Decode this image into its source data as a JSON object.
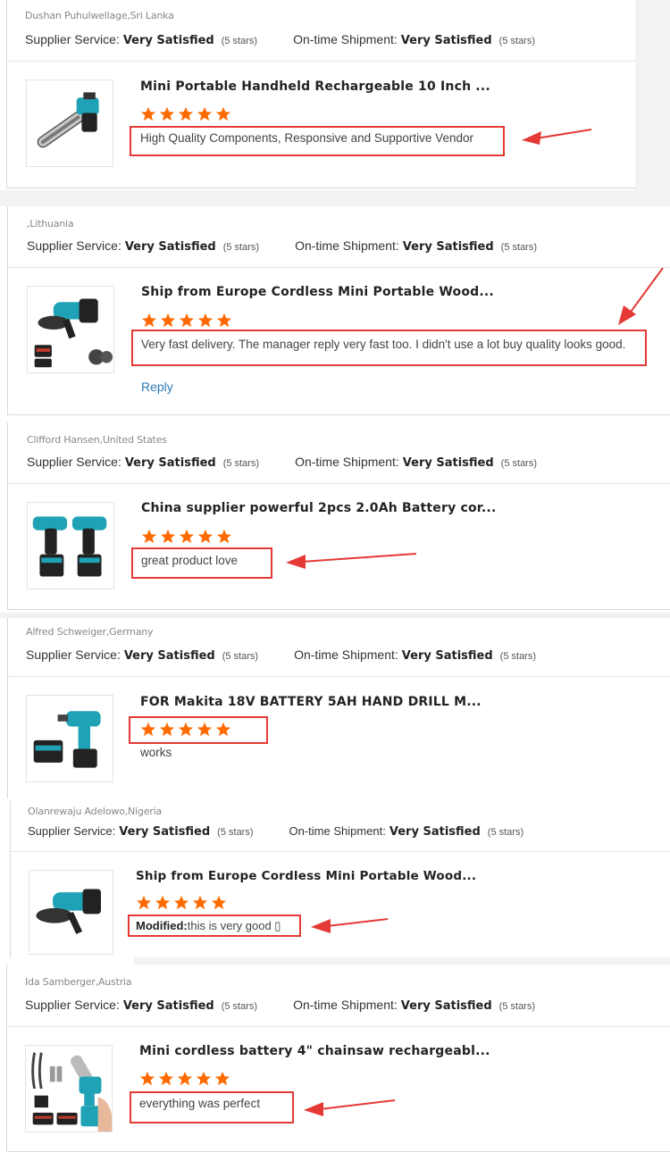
{
  "labels": {
    "supplier_service": "Supplier Service:",
    "ontime_shipment": "On-time Shipment:",
    "rating_value": "Very Satisfied",
    "rating_stars": "(5 stars)",
    "modified": "Modified:",
    "reply": "Reply"
  },
  "colors": {
    "star": "#ff6a00",
    "highlight": "#e53935",
    "link": "#2a7ab8"
  },
  "reviews": [
    {
      "reviewer": "Dushan Puhulwellage,Sri Lanka",
      "product_title": "Mini Portable Handheld Rechargeable 10 Inch ...",
      "stars": 5,
      "comment": "High Quality Components, Responsive and Supportive Vendor",
      "product_icon": "chainsaw-icon"
    },
    {
      "reviewer": ",Lithuania",
      "product_title": "Ship from Europe Cordless Mini Portable Wood...",
      "stars": 5,
      "comment": "Very fast delivery. The manager reply very fast too. I didn't use a lot buy quality looks good.",
      "product_icon": "angle-grinder-icon"
    },
    {
      "reviewer": "Clifford Hansen,United States",
      "product_title": "China supplier powerful 2pcs 2.0Ah Battery cor...",
      "stars": 5,
      "comment": "great product love",
      "product_icon": "drill-set-icon"
    },
    {
      "reviewer": "Alfred Schweiger,Germany",
      "product_title": "FOR Makita 18V BATTERY 5AH HAND DRILL M...",
      "stars": 5,
      "comment": "works",
      "product_icon": "hand-drill-icon"
    },
    {
      "reviewer": "Olanrewaju Adelowo,Nigeria",
      "product_title": "Ship from Europe Cordless Mini Portable Wood...",
      "stars": 5,
      "comment": "this is very good ▯",
      "product_icon": "angle-grinder-icon"
    },
    {
      "reviewer": "Ida Samberger,Austria",
      "product_title": "Mini cordless battery 4\" chainsaw rechargeabl...",
      "stars": 5,
      "comment": "everything was perfect",
      "product_icon": "mini-chainsaw-icon"
    }
  ]
}
